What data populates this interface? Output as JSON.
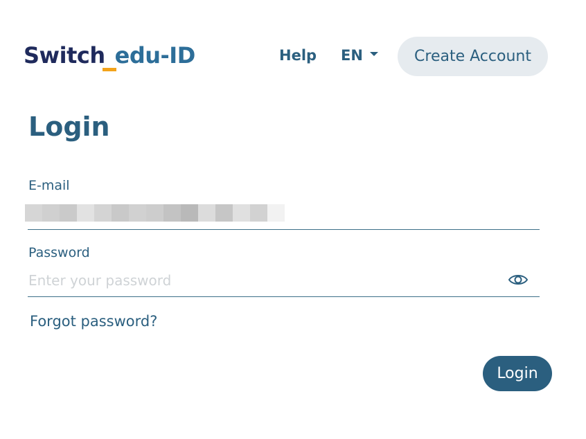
{
  "header": {
    "logo": {
      "part1": "Switch",
      "part2": "edu-ID",
      "underline_color": "#f3a31b"
    },
    "help_label": "Help",
    "language": {
      "selected": "EN"
    },
    "create_account_label": "Create Account"
  },
  "login": {
    "title": "Login",
    "email": {
      "label": "E-mail",
      "value_redacted": true
    },
    "password": {
      "label": "Password",
      "placeholder": "Enter your password",
      "value": ""
    },
    "forgot_password_label": "Forgot password?",
    "submit_label": "Login"
  },
  "colors": {
    "primary": "#2b5f7f",
    "logo_dark": "#1f2a5c",
    "logo_blue": "#2d6e99",
    "accent": "#f3a31b",
    "pill_bg": "#e6ebef"
  },
  "icons": {
    "password_toggle": "eye-icon",
    "language_dropdown": "caret-down-icon"
  }
}
